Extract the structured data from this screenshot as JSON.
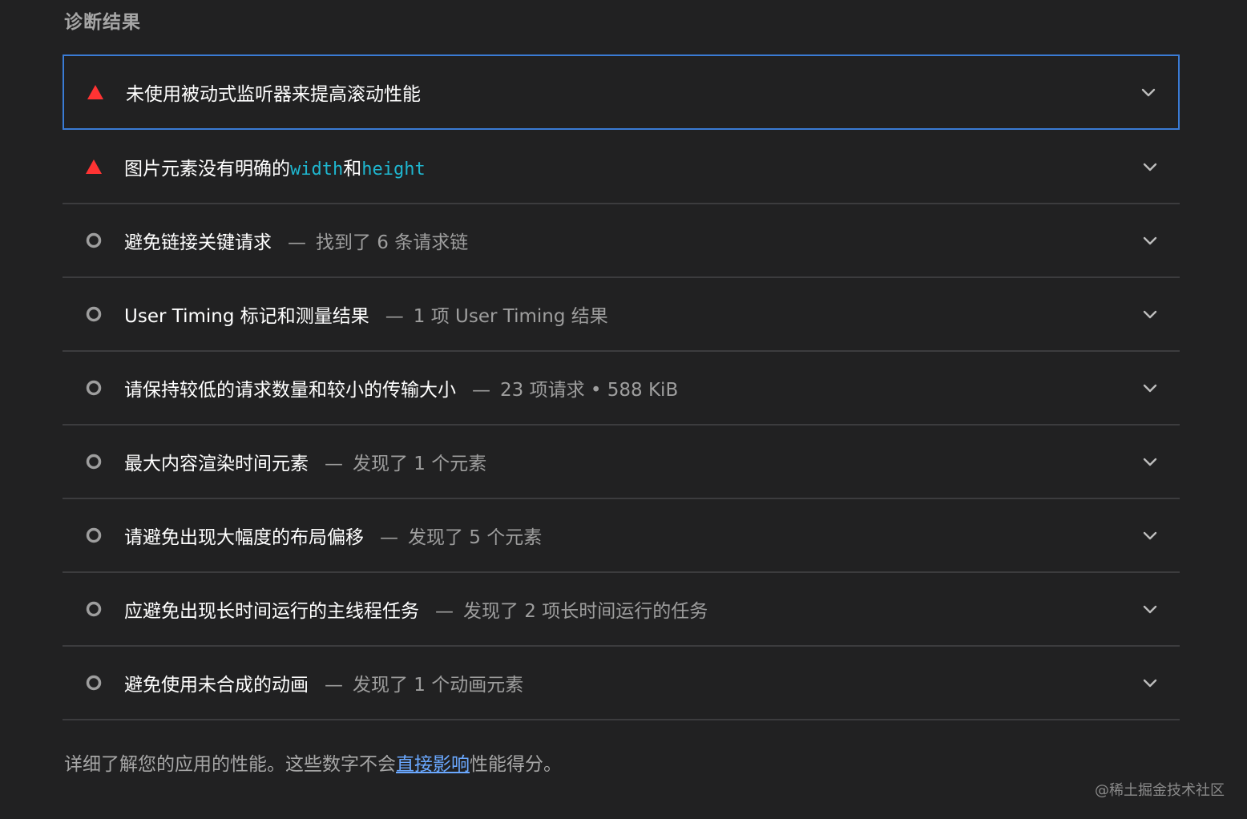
{
  "section": {
    "title": "诊断结果"
  },
  "audits": [
    {
      "status": "fail",
      "title": "未使用被动式监听器来提高滚动性能",
      "summary": ""
    },
    {
      "status": "fail",
      "title": "图片元素没有明确的",
      "code1": "width",
      "mid": "和",
      "code2": "height",
      "summary": ""
    },
    {
      "status": "info",
      "title": "避免链接关键请求",
      "sep": "—",
      "summary": "找到了 6 条请求链"
    },
    {
      "status": "info",
      "title": "User Timing 标记和测量结果",
      "sep": "—",
      "summary": "1 项 User Timing 结果"
    },
    {
      "status": "info",
      "title": "请保持较低的请求数量和较小的传输大小",
      "sep": "—",
      "summary": "23 项请求 • 588 KiB"
    },
    {
      "status": "info",
      "title": "最大内容渲染时间元素",
      "sep": "—",
      "summary": "发现了 1 个元素"
    },
    {
      "status": "info",
      "title": "请避免出现大幅度的布局偏移",
      "sep": "—",
      "summary": "发现了 5 个元素"
    },
    {
      "status": "info",
      "title": "应避免出现长时间运行的主线程任务",
      "sep": "—",
      "summary": "发现了 2 项长时间运行的任务"
    },
    {
      "status": "info",
      "title": "避免使用未合成的动画",
      "sep": "—",
      "summary": "发现了 1 个动画元素"
    }
  ],
  "footer": {
    "prefix": "详细了解您的应用的性能。这些数字不会",
    "link": "直接影响",
    "suffix": "性能得分。"
  },
  "watermark": "@稀土掘金技术社区",
  "colors": {
    "background": "#212122",
    "fail": "#ff3333",
    "info": "#9e9e9e",
    "focus_border": "#3a7bd5",
    "code": "#1fb6cf",
    "link": "#6aa8ff"
  },
  "icons": {
    "fail": "warning-triangle-icon",
    "info": "info-circle-icon",
    "expand": "chevron-down-icon"
  }
}
